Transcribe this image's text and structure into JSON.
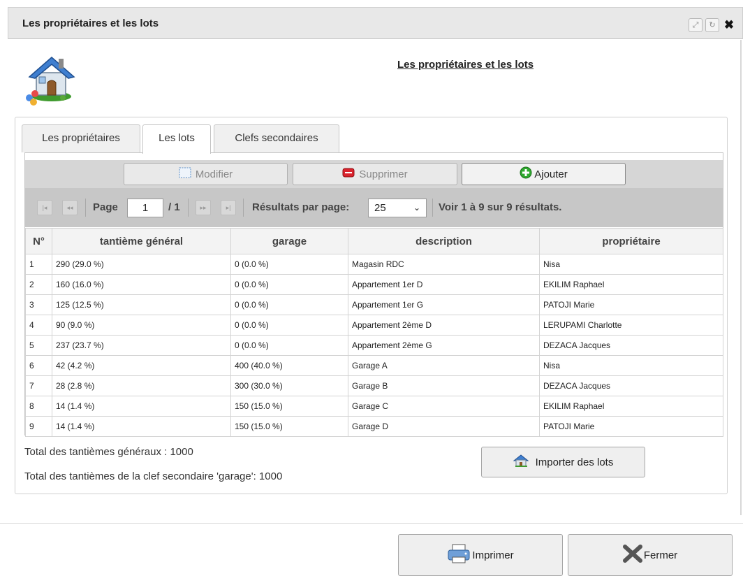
{
  "window": {
    "title": "Les propriétaires et les lots"
  },
  "header": {
    "page_title": "Les propriétaires et les lots"
  },
  "tabs": [
    {
      "label": "Les propriétaires",
      "active": false
    },
    {
      "label": "Les lots",
      "active": true
    },
    {
      "label": "Clefs secondaires",
      "active": false
    }
  ],
  "toolbar": {
    "modify_label": "Modifier",
    "delete_label": "Supprimer",
    "add_label": "Ajouter"
  },
  "pager": {
    "page_label": "Page",
    "current_page": "1",
    "total_pages": "/ 1",
    "per_page_label": "Résultats par page:",
    "per_page_value": "25",
    "summary": "Voir 1 à 9 sur 9 résultats."
  },
  "table": {
    "columns": [
      "N°",
      "tantième général",
      "garage",
      "description",
      "propriétaire"
    ],
    "rows": [
      [
        "1",
        "290 (29.0 %)",
        "0 (0.0 %)",
        "Magasin RDC",
        "Nisa"
      ],
      [
        "2",
        "160 (16.0 %)",
        "0 (0.0 %)",
        "Appartement 1er D",
        "EKILIM Raphael"
      ],
      [
        "3",
        "125 (12.5 %)",
        "0 (0.0 %)",
        "Appartement 1er G",
        "PATOJI Marie"
      ],
      [
        "4",
        "90 (9.0 %)",
        "0 (0.0 %)",
        "Appartement 2ème D",
        "LERUPAMI Charlotte"
      ],
      [
        "5",
        "237 (23.7 %)",
        "0 (0.0 %)",
        "Appartement 2ème G",
        "DEZACA Jacques"
      ],
      [
        "6",
        "42 (4.2 %)",
        "400 (40.0 %)",
        "Garage A",
        "Nisa"
      ],
      [
        "7",
        "28 (2.8 %)",
        "300 (30.0 %)",
        "Garage B",
        "DEZACA Jacques"
      ],
      [
        "8",
        "14 (1.4 %)",
        "150 (15.0 %)",
        "Garage C",
        "EKILIM Raphael"
      ],
      [
        "9",
        "14 (1.4 %)",
        "150 (15.0 %)",
        "Garage D",
        "PATOJI Marie"
      ]
    ]
  },
  "totals": {
    "general": "Total des tantièmes généraux : 1000",
    "garage": "Total des tantièmes de la clef secondaire 'garage': 1000"
  },
  "buttons": {
    "import_label": "Importer des lots",
    "print_label": "Imprimer",
    "close_label": "Fermer"
  },
  "colors": {
    "title_bar": "#e8e8e8",
    "pager_bg": "#c7c7c7",
    "add_icon": "#2ea82e",
    "delete_icon": "#d9232d"
  }
}
